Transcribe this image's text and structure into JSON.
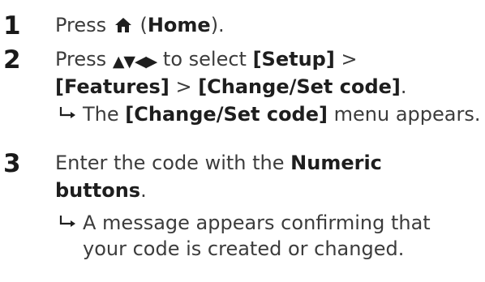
{
  "steps": [
    {
      "number": "1",
      "press": "Press",
      "icon": "home-icon",
      "open_paren": "(",
      "home": "Home",
      "close_paren": ")."
    },
    {
      "number": "2",
      "press": "Press",
      "nav_keys": "▲▼◀▶",
      "to_select": "to select",
      "setup": "[Setup]",
      "sep1": ">",
      "features": "[Features]",
      "sep2": ">",
      "change_set": "[Change/Set code]",
      "period": ".",
      "result_icon": "result-arrow-icon",
      "result_pre": "The",
      "result_menu": "[Change/Set code]",
      "result_post": "menu appears."
    },
    {
      "number": "3",
      "line1_pre": "Enter the code with the",
      "numeric": "Numeric",
      "buttons": "buttons",
      "buttons_period": ".",
      "result_icon": "result-arrow-icon",
      "result_line1": "A message appears confirming that",
      "result_line2": "your code is created or changed."
    }
  ]
}
